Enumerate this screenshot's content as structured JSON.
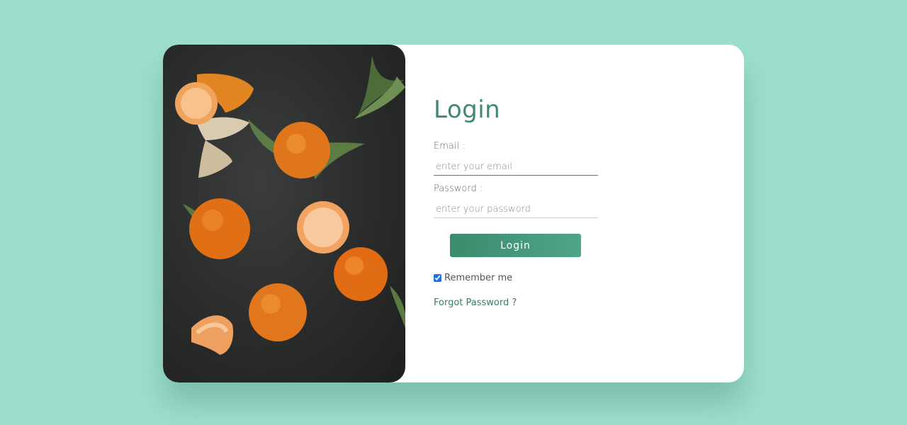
{
  "login_form": {
    "title": "Login",
    "email_label": "Email :",
    "email_placeholder": "enter your email",
    "password_label": "Password :",
    "password_placeholder": "enter your password",
    "submit_label": "Login",
    "remember_label": "Remember me",
    "remember_checked": true,
    "forgot_link": "Forgot Password ?"
  },
  "colors": {
    "page_background": "#9ddfcc",
    "accent": "#3d8a6e",
    "button_gradient_start": "#3b8b6c",
    "button_gradient_end": "#4fa58a"
  },
  "photo": {
    "subject": "tangerines on dark slate"
  }
}
